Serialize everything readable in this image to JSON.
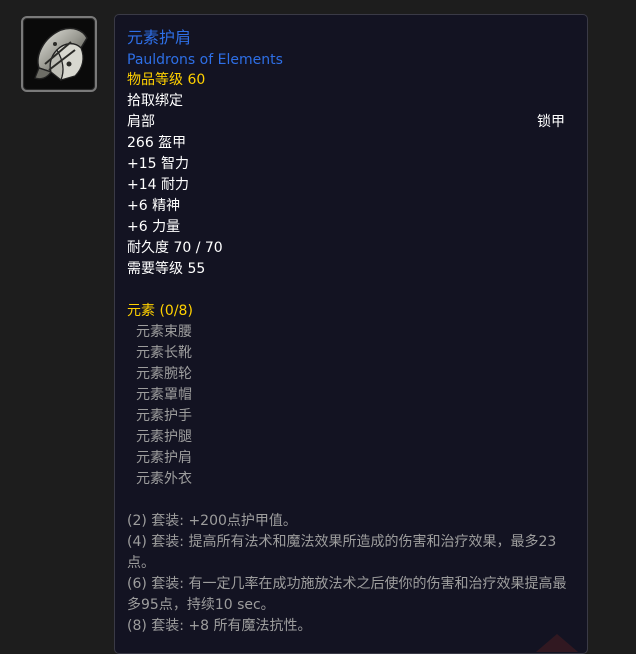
{
  "icon": {
    "name": "pauldrons-icon"
  },
  "item": {
    "name_cn": "元素护肩",
    "name_en": "Pauldrons of Elements",
    "item_level": "物品等级 60",
    "bind": "拾取绑定",
    "slot": "肩部",
    "armor_type": "锁甲",
    "armor": "266 盔甲",
    "stats": [
      "+15 智力",
      "+14 耐力",
      "+6 精神",
      "+6 力量"
    ],
    "durability": "耐久度 70 / 70",
    "required_level": "需要等级 55"
  },
  "set": {
    "title": "元素 (0/8)",
    "pieces": [
      "元素束腰",
      "元素长靴",
      "元素腕轮",
      "元素罩帽",
      "元素护手",
      "元素护腿",
      "元素护肩",
      "元素外衣"
    ],
    "bonuses": [
      "(2) 套装: +200点护甲值。",
      "(4) 套装: 提高所有法术和魔法效果所造成的伤害和治疗效果，最多23点。",
      "(6) 套装: 有一定几率在成功施放法术之后使你的伤害和治疗效果提高最多95点，持续10 sec。",
      "(8) 套装: +8 所有魔法抗性。"
    ]
  },
  "colors": {
    "page_bg": "#1d1d1d",
    "tooltip_bg": "#131322",
    "item_name": "#2e6fe6",
    "gold": "#ffd100",
    "text": "#ffffff",
    "inactive": "#9d9d9d"
  }
}
